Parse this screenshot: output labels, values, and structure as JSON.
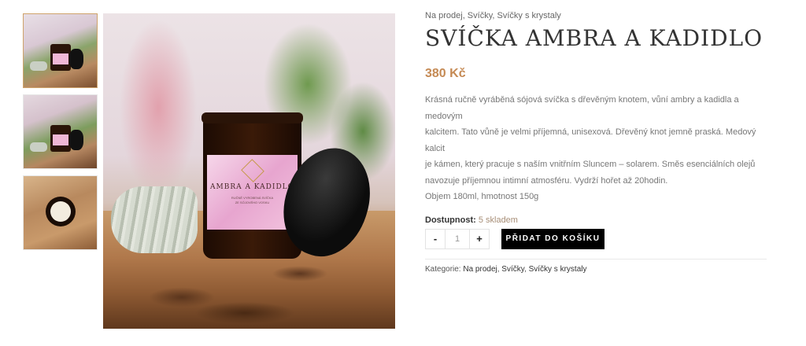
{
  "gallery": {
    "thumbnails": [
      {
        "alt": "candle-jar-front"
      },
      {
        "alt": "candle-jar-open"
      },
      {
        "alt": "candle-top-view"
      }
    ],
    "main_label_title": "AMBRA A KADIDLO",
    "main_label_sub": "RUČNĚ VYROBENÁ SVÍČKA\nZE SÓJOVÉHO VOSKU",
    "zoom_icon": "search-icon"
  },
  "product": {
    "categories_breadcrumb": "Na prodej, Svíčky, Svíčky s krystaly",
    "title": "SVÍČKA AMBRA A KADIDLO",
    "price": "380 Kč",
    "description_lines": [
      "Krásná ručně vyráběná sójová svíčka s dřevěným knotem, vůní ambry a kadidla a medovým",
      "kalcitem. Tato vůně je velmi příjemná, unisexová. Dřevěný knot jemně praská. Medový kalcit",
      "je kámen, který pracuje s naším vnitřním Sluncem – solarem. Směs esenciálních olejů",
      "navozuje příjemnou intimní atmosféru. Vydrží hořet až 20hodin.",
      "Objem 180ml, hmotnost 150g"
    ],
    "availability_label": "Dostupnost:",
    "availability_value": "5 skladem",
    "quantity": "1",
    "minus_label": "-",
    "plus_label": "+",
    "add_to_cart": "PŘIDAT DO KOŠÍKU",
    "meta_label": "Kategorie:",
    "meta_categories": [
      "Na prodej",
      "Svíčky",
      "Svíčky s krystaly"
    ]
  },
  "colors": {
    "price": "#c58a54",
    "button_bg": "#000000",
    "stock_value": "#a88f78"
  }
}
